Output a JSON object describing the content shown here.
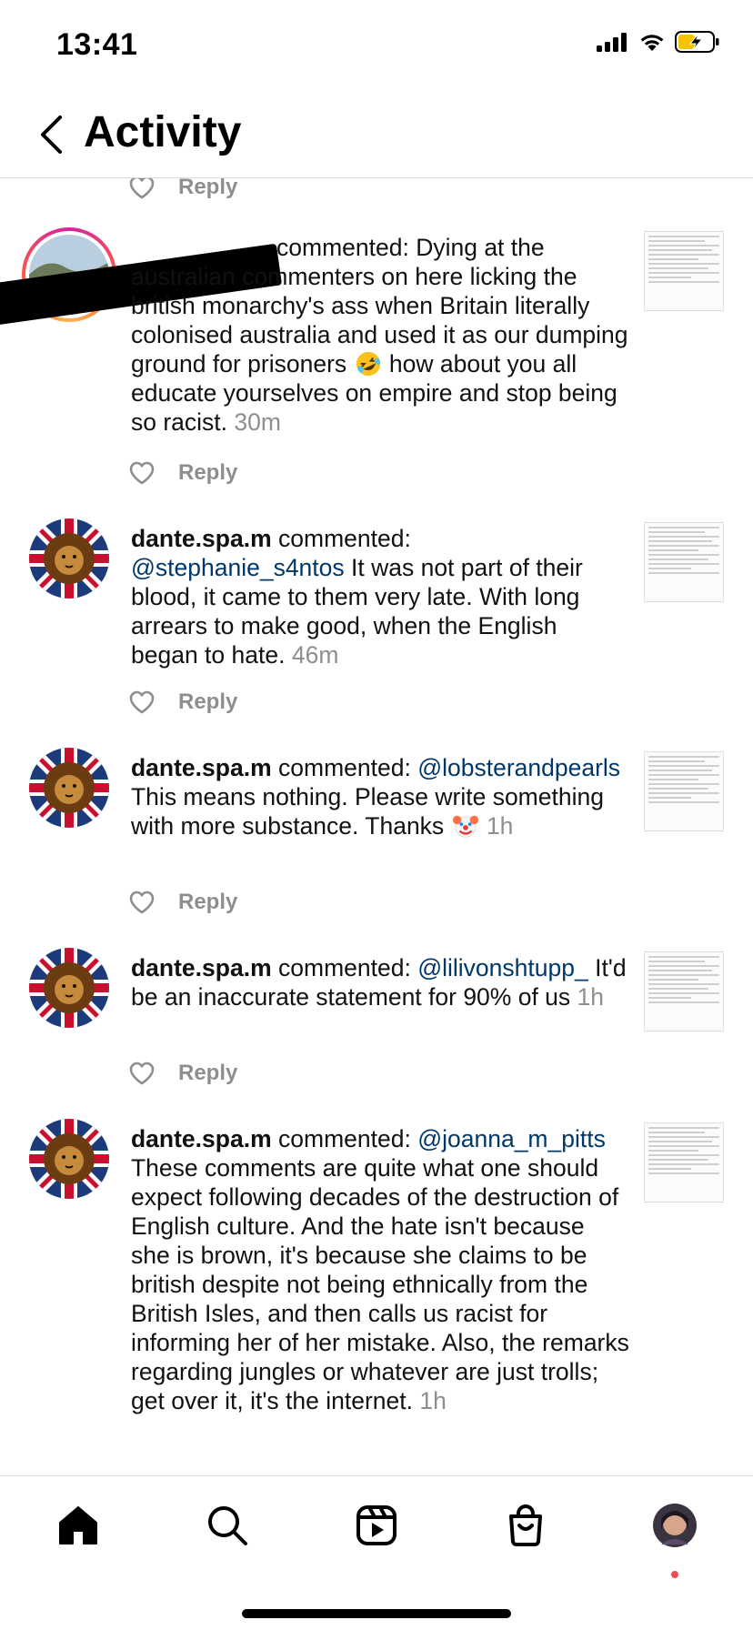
{
  "status_bar": {
    "time": "13:41"
  },
  "header": {
    "title": "Activity"
  },
  "reply_label": "Reply",
  "comments": [
    {
      "user": "",
      "verb": "commented:",
      "mention": "",
      "text": "Dying at the australian commenters on here licking the british monarchy's ass when Britain literally colonised australia and used it as our dumping ground for prisoners",
      "emoji": "rolling-on-floor-laughing",
      "text_after": "how about you all educate yourselves on empire and stop being so racist.",
      "time": "30m"
    },
    {
      "user": "dante.spa.m",
      "verb": "commented:",
      "mention": "@stephanie_s4ntos",
      "text": "It was not part of their blood, it came to them very late. With long arrears to make good, when the English began to hate.",
      "time": "46m"
    },
    {
      "user": "dante.spa.m",
      "verb": "commented:",
      "mention": "@lobsterandpearls",
      "text": "This means nothing. Please write something with more substance. Thanks",
      "emoji": "clown-face",
      "time": "1h"
    },
    {
      "user": "dante.spa.m",
      "verb": "commented:",
      "mention": "@lilivonshtupp_",
      "text": "It'd be an inaccurate statement for 90% of us",
      "time": "1h"
    },
    {
      "user": "dante.spa.m",
      "verb": "commented:",
      "mention": "@joanna_m_pitts",
      "text": "These comments are quite what one should expect following decades of the destruction of English culture. And the hate isn't because she is brown, it's because she claims to be british despite not being ethnically from the British Isles, and then calls us racist for informing her of her mistake. Also, the remarks regarding jungles or whatever are just trolls; get over it, it's the internet.",
      "time": "1h"
    }
  ],
  "icons": {
    "back": "chevron-left-icon",
    "home": "home-icon",
    "search": "search-icon",
    "reels": "reels-icon",
    "shop": "shop-icon",
    "profile": "profile-avatar"
  },
  "colors": {
    "mention": "#00376b",
    "muted": "#8e8e8e",
    "notification_dot": "#ed4956"
  }
}
